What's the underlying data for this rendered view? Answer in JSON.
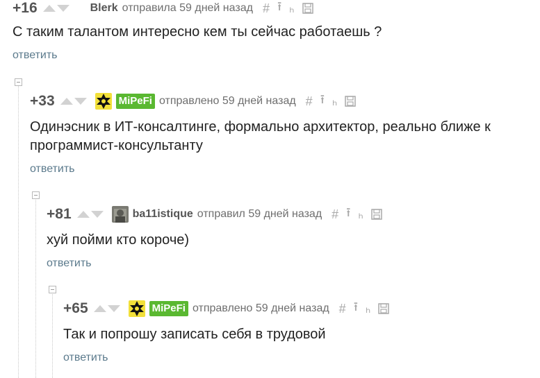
{
  "comments": [
    {
      "rating": "+16",
      "username": "Blerk",
      "posted": "отправила 59 дней назад",
      "text": "С таким талантом интересно кем ты сейчас работаешь ?",
      "reply": "ответить"
    },
    {
      "rating": "+33",
      "username": "MiPeFi",
      "posted": "отправлено 59 дней назад",
      "text_lines": [
        "Одинэсник в ИТ-консалтинге, формально архитектор, реально ближе к",
        "программист-консультанту"
      ],
      "reply": "ответить"
    },
    {
      "rating": "+81",
      "username": "ba11istique",
      "posted": "отправил 59 дней назад",
      "text": "хуй пойми кто короче)",
      "reply": "ответить"
    },
    {
      "rating": "+65",
      "username": "MiPeFi",
      "posted": "отправлено 59 дней назад",
      "text": "Так и попрошу записать себя в трудовой",
      "reply": "ответить"
    }
  ],
  "tools": {
    "link": "#",
    "parent": "⭱",
    "branch": "ₕ"
  },
  "colors": {
    "badge": "#5ab831",
    "reply_link": "#5b7a8c",
    "rating": "#555555"
  },
  "icons": [
    "link-hash-icon",
    "go-to-parent-icon",
    "branch-icon",
    "save-icon",
    "collapse-icon",
    "vote-up-icon",
    "vote-down-icon"
  ]
}
